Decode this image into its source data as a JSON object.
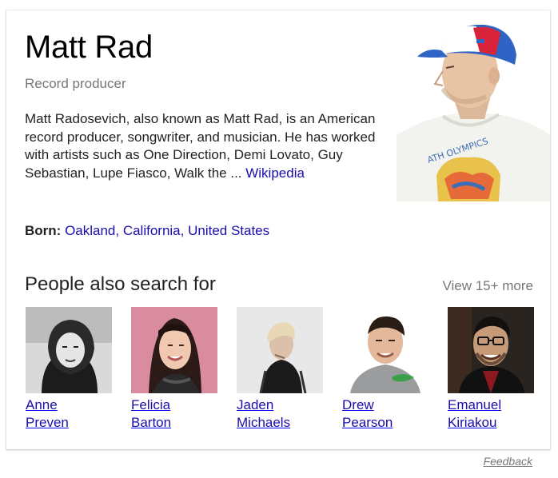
{
  "entity": {
    "name": "Matt Rad",
    "type": "Record producer",
    "description": "Matt Radosevich, also known as Matt Rad, is an American record producer, songwriter, and musician. He has worked with artists such as One Direction, Demi Lovato, Guy Sebastian, Lupe Fiasco, Walk the ... ",
    "source_link": "Wikipedia",
    "born_label": "Born:",
    "born_value": "Oakland, California, United States"
  },
  "related": {
    "title": "People also search for",
    "view_more": "View 15+ more",
    "people": [
      {
        "first": "Anne",
        "last": "Preven"
      },
      {
        "first": "Felicia",
        "last": "Barton"
      },
      {
        "first": "Jaden",
        "last": "Michaels"
      },
      {
        "first": "Drew",
        "last": "Pearson"
      },
      {
        "first": "Emanuel",
        "last": "Kiriakou"
      }
    ]
  },
  "feedback": "Feedback",
  "colors": {
    "link": "#1a0dab",
    "muted": "#777777",
    "text": "#222222"
  }
}
